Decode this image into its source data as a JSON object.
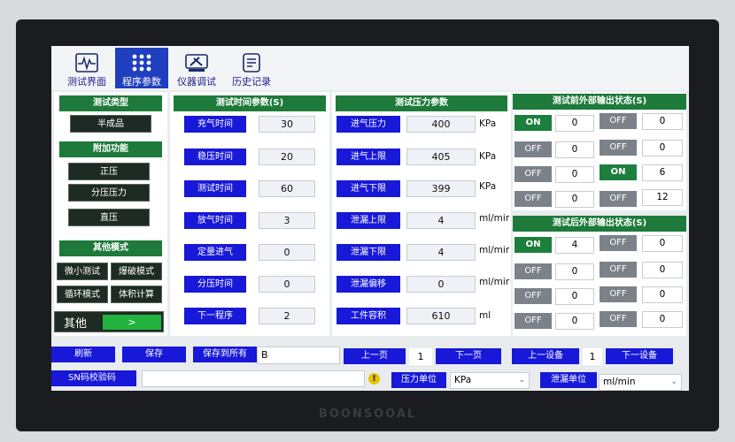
{
  "brand": "BOONSOOAL",
  "tabs": [
    {
      "label": "测试界面",
      "icon": "waveform-icon"
    },
    {
      "label": "程序参数",
      "icon": "dots-grid-icon"
    },
    {
      "label": "仪器调试",
      "icon": "tools-icon"
    },
    {
      "label": "历史记录",
      "icon": "history-icon"
    }
  ],
  "left": {
    "test_type_header": "测试类型",
    "test_type_value": "半成品",
    "addon_header": "附加功能",
    "addons": [
      "正压",
      "分压压力",
      "直压"
    ],
    "other_mode_header": "其他模式",
    "modes": [
      "微小测试",
      "爆破模式",
      "循环模式",
      "体积计算"
    ],
    "other_label": "其他",
    "other_next": ">"
  },
  "time_params": {
    "header": "测试时间参数(S)",
    "rows": [
      {
        "label": "充气时间",
        "value": "30"
      },
      {
        "label": "稳压时间",
        "value": "20"
      },
      {
        "label": "测试时间",
        "value": "60"
      },
      {
        "label": "放气时间",
        "value": "3"
      },
      {
        "label": "定量进气",
        "value": "0"
      },
      {
        "label": "分压时间",
        "value": "0"
      },
      {
        "label": "下一程序",
        "value": "2"
      }
    ]
  },
  "pressure_params": {
    "header": "测试压力参数",
    "rows": [
      {
        "label": "进气压力",
        "value": "400",
        "unit": "KPa"
      },
      {
        "label": "进气上限",
        "value": "405",
        "unit": "KPa"
      },
      {
        "label": "进气下限",
        "value": "399",
        "unit": "KPa"
      },
      {
        "label": "泄漏上限",
        "value": "4",
        "unit": "ml/mir"
      },
      {
        "label": "泄漏下限",
        "value": "4",
        "unit": "ml/mir"
      },
      {
        "label": "泄漏偏移",
        "value": "0",
        "unit": "ml/mir"
      },
      {
        "label": "工件容积",
        "value": "610",
        "unit": "ml"
      }
    ]
  },
  "pre_output": {
    "header": "测试前外部输出状态(S)",
    "rows": [
      {
        "a_state": "ON",
        "a_val": "0",
        "b_state": "OFF",
        "b_val": "0"
      },
      {
        "a_state": "OFF",
        "a_val": "0",
        "b_state": "OFF",
        "b_val": "0"
      },
      {
        "a_state": "OFF",
        "a_val": "0",
        "b_state": "ON",
        "b_val": "6"
      },
      {
        "a_state": "OFF",
        "a_val": "0",
        "b_state": "OFF",
        "b_val": "12"
      }
    ]
  },
  "post_output": {
    "header": "测试后外部输出状态(S)",
    "rows": [
      {
        "a_state": "ON",
        "a_val": "4",
        "b_state": "OFF",
        "b_val": "0"
      },
      {
        "a_state": "OFF",
        "a_val": "0",
        "b_state": "OFF",
        "b_val": "0"
      },
      {
        "a_state": "OFF",
        "a_val": "0",
        "b_state": "OFF",
        "b_val": "0"
      },
      {
        "a_state": "OFF",
        "a_val": "0",
        "b_state": "OFF",
        "b_val": "0"
      }
    ]
  },
  "bottom": {
    "refresh": "刷新",
    "save": "保存",
    "save_all": "保存到所有",
    "program_name": "B",
    "prev_page": "上一页",
    "page": "1",
    "next_page": "下一页",
    "prev_device": "上一设备",
    "device": "1",
    "next_device": "下一设备",
    "sn_verify": "SN码校验码",
    "sn_value": "",
    "warning": "!",
    "pressure_unit_label": "压力单位",
    "pressure_unit": "KPa",
    "leak_unit_label": "泄漏单位",
    "leak_unit": "ml/min"
  },
  "colors": {
    "header_green": "#1d7a3a",
    "button_blue": "#1818d8",
    "on_green": "#1c7f3c",
    "off_gray": "#7b8289",
    "tab_active": "#1f3fbf"
  }
}
